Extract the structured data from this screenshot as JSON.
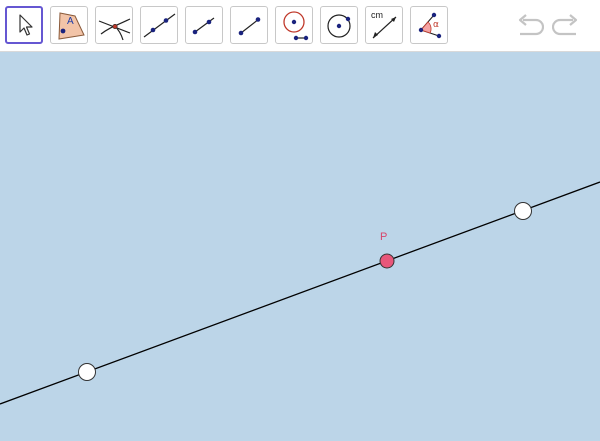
{
  "toolbar": {
    "tools": [
      {
        "id": "move",
        "icon": "arrow-cursor-icon",
        "active": true
      },
      {
        "id": "polygon",
        "icon": "polygon-icon",
        "glyph": "A"
      },
      {
        "id": "intersect",
        "icon": "intersect-icon"
      },
      {
        "id": "line",
        "icon": "line-icon"
      },
      {
        "id": "segment",
        "icon": "segment-icon"
      },
      {
        "id": "ray",
        "icon": "ray-icon"
      },
      {
        "id": "circle",
        "icon": "circle-center-radius-icon"
      },
      {
        "id": "circle-center-point",
        "icon": "circle-center-point-icon"
      },
      {
        "id": "distance",
        "icon": "distance-length-icon",
        "glyph": "cm"
      },
      {
        "id": "angle",
        "icon": "angle-icon",
        "glyph": "α"
      }
    ],
    "undo": {
      "icon": "undo-icon",
      "enabled": false
    },
    "redo": {
      "icon": "redo-icon",
      "enabled": false
    }
  },
  "canvas": {
    "background": "#bcd5e8",
    "point_p": {
      "label": "P",
      "color": "#e8577a"
    },
    "line_color": "#000000",
    "free_point_color": "#ffffff"
  }
}
